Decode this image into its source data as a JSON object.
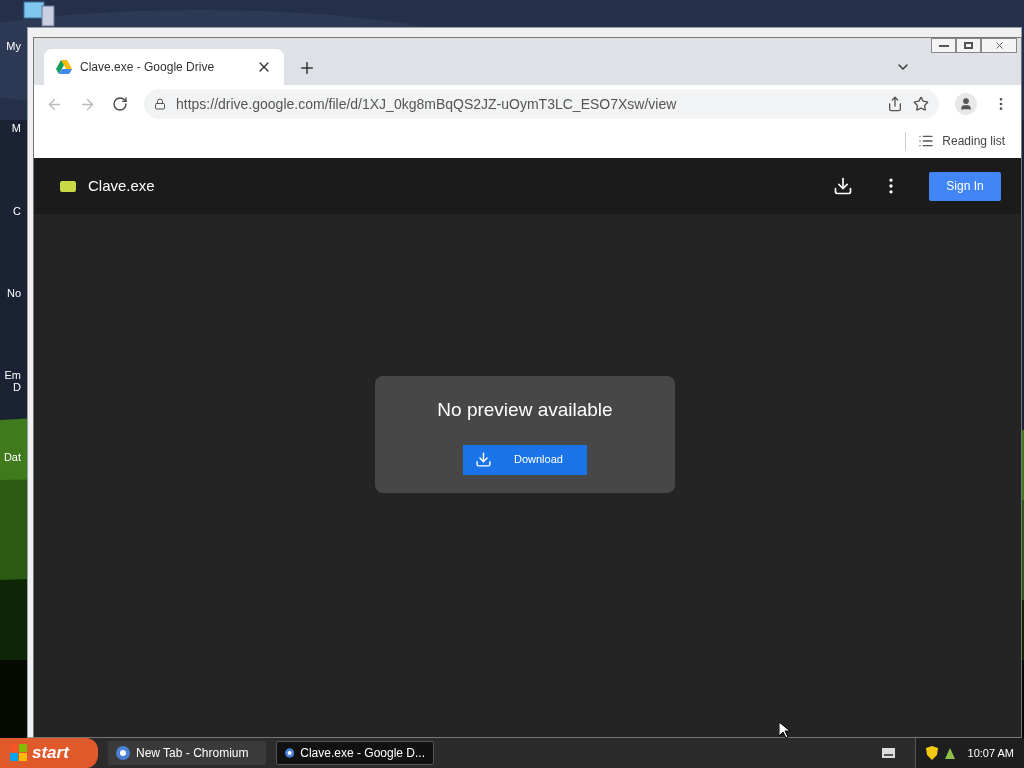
{
  "desktop": {
    "icon_labels": [
      "My",
      "M",
      "C",
      "No",
      "Em",
      "D",
      "Dat"
    ]
  },
  "browser": {
    "tabs": [
      {
        "title": "Clave.exe - Google Drive",
        "selected": true
      }
    ],
    "url": "https://drive.google.com/file/d/1XJ_0kg8mBqQS2JZ-uOymT3LC_ESO7Xsw/view",
    "reading_list": "Reading list"
  },
  "drive": {
    "file_name": "Clave.exe",
    "sign_in": "Sign In",
    "message": "No preview available",
    "download": "Download"
  },
  "taskbar": {
    "start": "start",
    "tasks": [
      {
        "label": "New Tab - Chromium",
        "selected": false
      },
      {
        "label": "Clave.exe - Google D...",
        "selected": true
      }
    ],
    "clock": "10:07 AM"
  }
}
